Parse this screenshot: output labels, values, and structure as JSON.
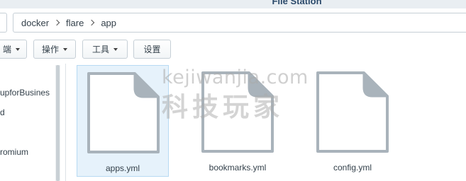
{
  "window": {
    "title": "File Station"
  },
  "path": {
    "segments": [
      "docker",
      "flare",
      "app"
    ]
  },
  "toolbar": {
    "partial_label": "端",
    "action_label": "操作",
    "tools_label": "工具",
    "settings_label": "设置"
  },
  "sidebar": {
    "items": [
      {
        "label": "upforBusines"
      },
      {
        "label": "d"
      },
      {
        "label": "romium"
      }
    ]
  },
  "files": [
    {
      "name": "apps.yml",
      "selected": true,
      "icon": "file-icon"
    },
    {
      "name": "bookmarks.yml",
      "selected": false,
      "icon": "file-icon"
    },
    {
      "name": "config.yml",
      "selected": false,
      "icon": "file-icon"
    }
  ],
  "watermark": {
    "line1": "kejiwanjia.com",
    "line2": "科技玩家"
  },
  "colors": {
    "selection": "#e6f2fb",
    "selection_border": "#b7daf3",
    "file_icon_outline": "#a9b3bb"
  }
}
